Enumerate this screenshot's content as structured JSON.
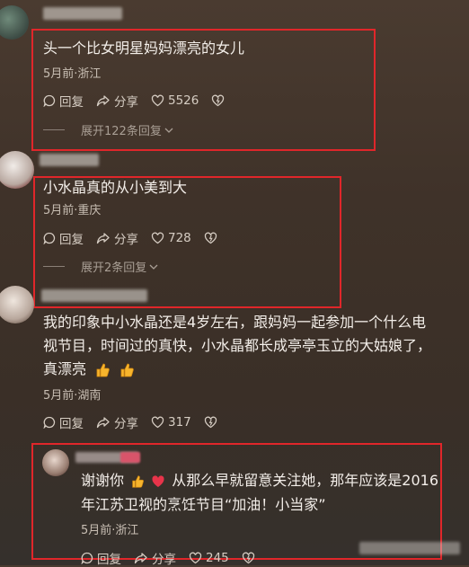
{
  "comments": [
    {
      "text": "头一个比女明星妈妈漂亮的女儿",
      "meta": "5月前·浙江",
      "reply_label": "回复",
      "share_label": "分享",
      "likes": "5526",
      "expand_label": "展开122条回复"
    },
    {
      "text": "小水晶真的从小美到大",
      "meta": "5月前·重庆",
      "reply_label": "回复",
      "share_label": "分享",
      "likes": "728",
      "expand_label": "展开2条回复"
    },
    {
      "text_line1": "我的印象中小水晶还是4岁左右，跟妈妈一起参加一个什么电",
      "text_line2": "视节目，时间过的真快，小水晶都长成亭亭玉立的大姑娘了，",
      "text_line3": "真漂亮",
      "meta": "5月前·湖南",
      "reply_label": "回复",
      "share_label": "分享",
      "likes": "317"
    },
    {
      "text_line1a": "谢谢你",
      "text_line1b": "从那么早就留意关注她，那年应该是2016",
      "text_line2": "年江苏卫视的烹饪节目“加油！小当家”",
      "meta": "5月前·浙江",
      "reply_label": "回复",
      "share_label": "分享",
      "likes": "245"
    }
  ],
  "colors": {
    "highlight_box": "#e0262a",
    "background": "#3f3229"
  },
  "icons": [
    "reply-icon",
    "share-icon",
    "heart-icon",
    "dislike-icon",
    "chevron-down-icon",
    "thumbs-up-emoji",
    "heart-emoji"
  ]
}
